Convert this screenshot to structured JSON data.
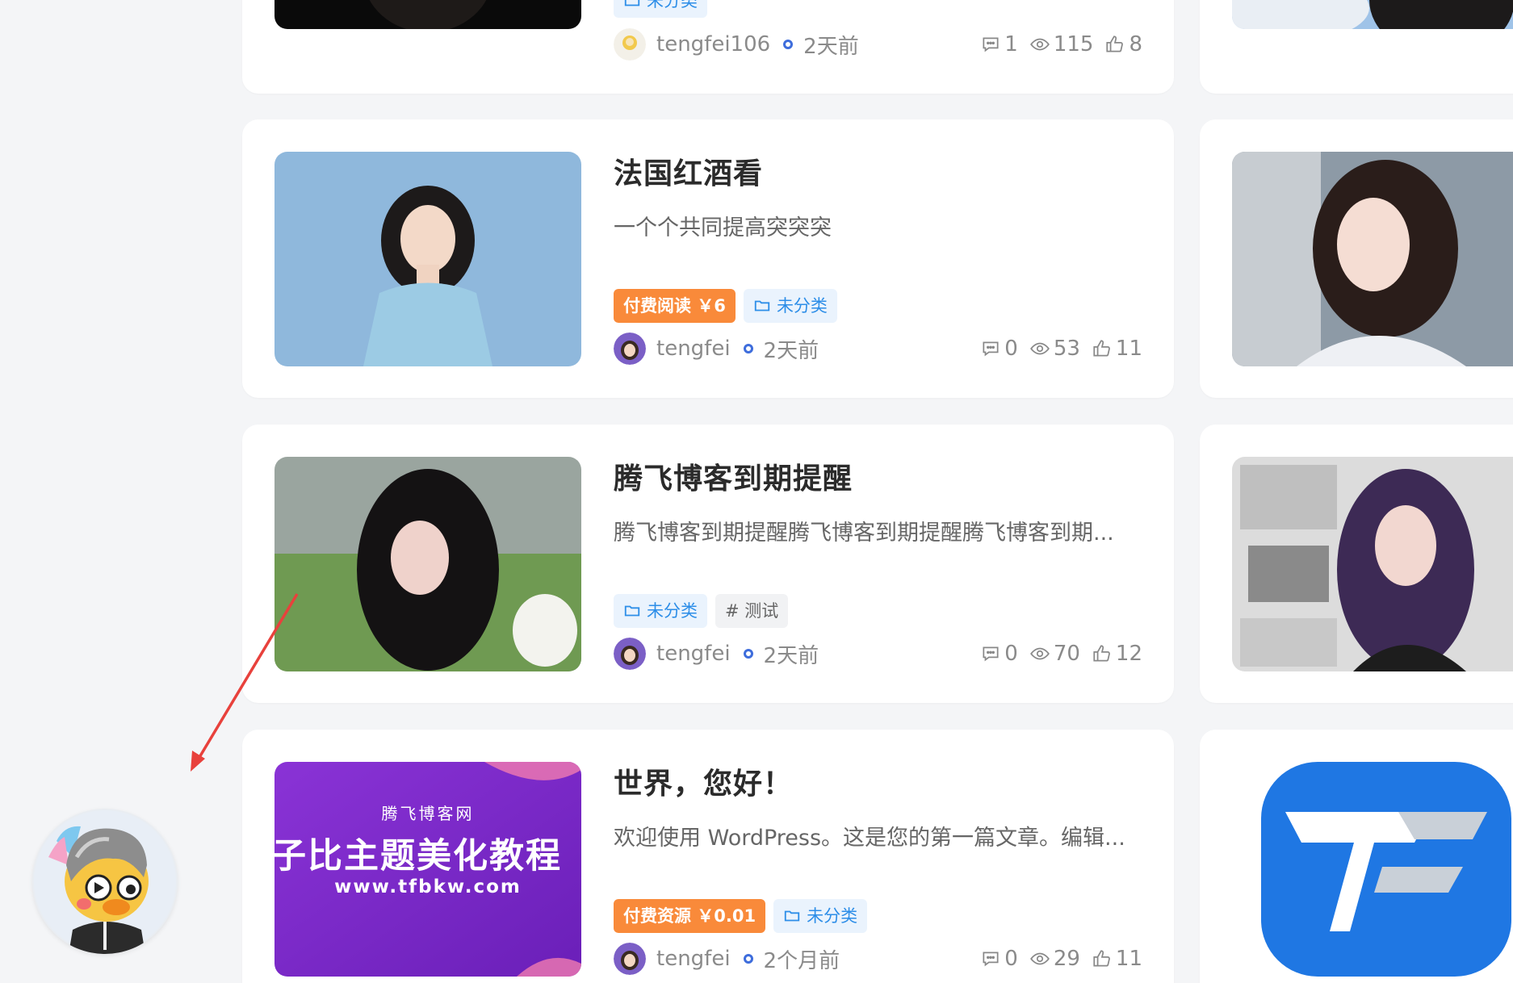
{
  "posts": [
    {
      "title": "",
      "excerpt": "",
      "tags": [
        {
          "type": "cat",
          "label": "未分类"
        }
      ],
      "author": "tengfei106",
      "time": "2天前",
      "comments": "1",
      "views": "115",
      "likes": "8"
    },
    {
      "title": "法国红酒看",
      "excerpt": "一个个共同提高突突突",
      "tags": [
        {
          "type": "paid",
          "label": "付费阅读 ￥6"
        },
        {
          "type": "cat",
          "label": "未分类"
        }
      ],
      "author": "tengfei",
      "time": "2天前",
      "comments": "0",
      "views": "53",
      "likes": "11"
    },
    {
      "title": "腾飞博客到期提醒",
      "excerpt": "腾飞博客到期提醒腾飞博客到期提醒腾飞博客到期...",
      "tags": [
        {
          "type": "cat",
          "label": "未分类"
        },
        {
          "type": "label",
          "label": "# 测试"
        }
      ],
      "author": "tengfei",
      "time": "2天前",
      "comments": "0",
      "views": "70",
      "likes": "12"
    },
    {
      "title": "世界，您好！",
      "excerpt": "欢迎使用 WordPress。这是您的第一篇文章。编辑...",
      "tags": [
        {
          "type": "paid",
          "label": "付费资源 ￥0.01"
        },
        {
          "type": "cat",
          "label": "未分类"
        }
      ],
      "author": "tengfei",
      "time": "2个月前",
      "comments": "0",
      "views": "29",
      "likes": "11"
    }
  ],
  "banner": {
    "site": "腾飞博客网",
    "headline": "子比主题美化教程",
    "url": "www.tfbkw.com"
  },
  "colors": {
    "paid_tag": "#f98a3a",
    "category_tag": "#2d8ee8",
    "accent_dot": "#3e6ddc",
    "annotation_arrow": "#e8413c",
    "logo_blue": "#1f77e3"
  }
}
